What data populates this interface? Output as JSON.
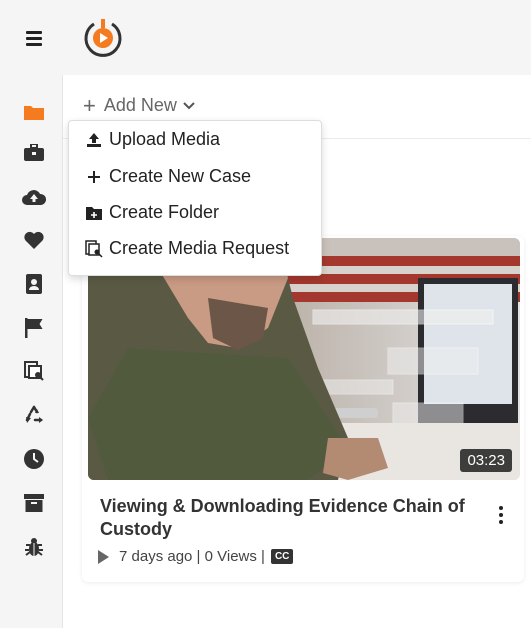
{
  "header": {
    "menu_icon": "hamburger-icon",
    "logo_icon": "app-logo"
  },
  "sidebar": {
    "items": [
      {
        "icon": "folder-icon",
        "color": "#f47b20"
      },
      {
        "icon": "briefcase-icon"
      },
      {
        "icon": "cloud-upload-icon"
      },
      {
        "icon": "heart-icon"
      },
      {
        "icon": "contact-card-icon"
      },
      {
        "icon": "flag-icon"
      },
      {
        "icon": "media-request-icon"
      },
      {
        "icon": "recycle-icon"
      },
      {
        "icon": "clock-icon"
      },
      {
        "icon": "archive-icon"
      },
      {
        "icon": "bug-icon"
      }
    ]
  },
  "toolbar": {
    "add_new_label": "Add New"
  },
  "dropdown": {
    "items": [
      {
        "label": "Upload Media",
        "icon": "upload-icon"
      },
      {
        "label": "Create New Case",
        "icon": "plus-icon"
      },
      {
        "label": "Create Folder",
        "icon": "folder-plus-icon"
      },
      {
        "label": "Create Media Request",
        "icon": "media-request-icon"
      }
    ]
  },
  "video": {
    "duration": "03:23",
    "title": "Viewing & Downloading Evidence Chain of Custody",
    "meta": "7 days ago | 0 Views |",
    "cc_label": "CC"
  },
  "colors": {
    "accent": "#f47b20",
    "icon": "#333333"
  }
}
